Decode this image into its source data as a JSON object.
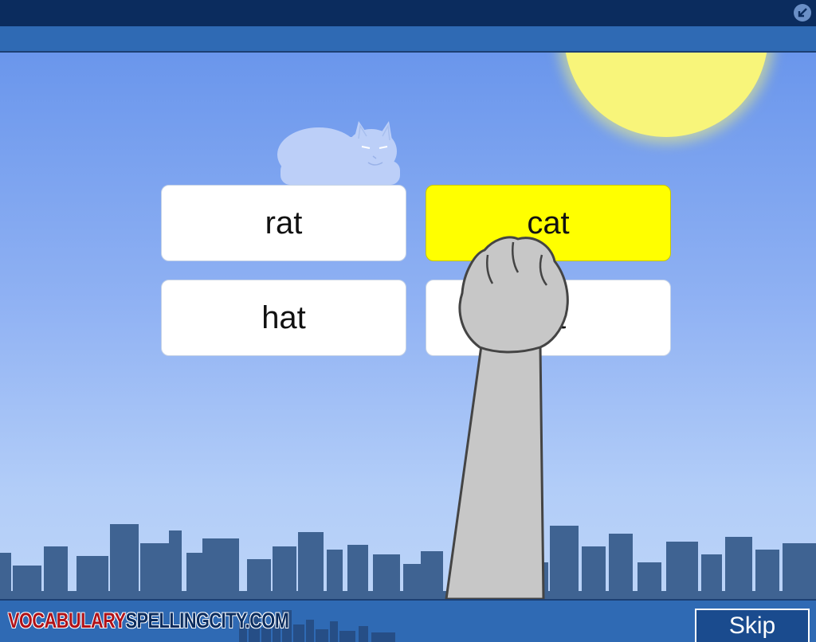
{
  "header": {
    "collapse_icon": "arrow-down-left-icon"
  },
  "game": {
    "choices": [
      {
        "label": "rat",
        "selected": false
      },
      {
        "label": "cat",
        "selected": true
      },
      {
        "label": "hat",
        "selected": false
      },
      {
        "label": "fat",
        "selected": false
      }
    ],
    "scene_icons": [
      "sun-icon",
      "cloud-cat-icon",
      "city-skyline-icon",
      "cat-paw-icon"
    ]
  },
  "footer": {
    "logo_left": "VOCABULARY",
    "logo_right": "SPELLINGCITY.COM",
    "skip_label": "Skip"
  },
  "colors": {
    "selected": "#ffff00",
    "sky_top": "#6a96ec",
    "sky_bottom": "#bcd4f8",
    "sun": "#f8f57a",
    "skyline": "#3f6392",
    "bar": "#2f6ab4",
    "top_bar": "#0b2c5e"
  }
}
